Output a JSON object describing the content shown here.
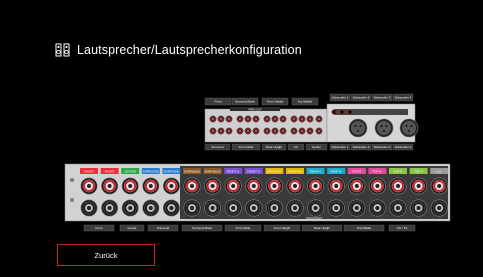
{
  "screen": {
    "title": "Lautsprecher/Lautsprecherkonfiguration",
    "back_label": "Zurück"
  },
  "panel_labels": {
    "small_top_row": [
      "Front",
      "Surround Back",
      "Front Height",
      "Top Middle"
    ],
    "small_bottom_row": [
      "Surround",
      "Front Wide",
      "Rear Height",
      "Ch",
      "Center"
    ],
    "preout_header": "PRE OUT",
    "aux_top_row": [
      "Subwoofer 1",
      "Subwoofer 2",
      "Subwoofer 3",
      "Subwoofer 4"
    ],
    "aux_bottom_row": [
      "Subwoofer 1",
      "Subwoofer 2",
      "Subwoofer 3",
      "Subwoofer 4"
    ],
    "channel_tags": [
      "FRONT",
      "FRONT",
      "CENTER",
      "SURROUND",
      "SURROUND",
      "SURR.BACK",
      "SURR.BACK",
      "FRONT H.",
      "FRONT H.",
      "FRONT W.",
      "FRONT W.",
      "REAR H.",
      "REAR H.",
      "TOP M.",
      "TOP M.",
      "TOP F.",
      "TOP F.",
      "C.H."
    ],
    "speakers_header": "SPEAKERS",
    "bottom_row": [
      "Front",
      "Center",
      "Surround",
      "Surround Back",
      "Front Wide",
      "Front Height",
      "Rear Height",
      "Top Middle",
      "CH / TS"
    ]
  },
  "colors": {
    "accent": "#c8232b",
    "tag_colors": [
      "#e8323b",
      "#e8323b",
      "#2fa84a",
      "#2a7ccd",
      "#2a7ccd",
      "#8a5a2b",
      "#8a5a2b",
      "#7a4fd0",
      "#7a4fd0",
      "#e3b510",
      "#e3b510",
      "#1eaac9",
      "#1eaac9",
      "#e04a9a",
      "#e04a9a",
      "#8bc34a",
      "#8bc34a",
      "#9c9c9c"
    ]
  }
}
